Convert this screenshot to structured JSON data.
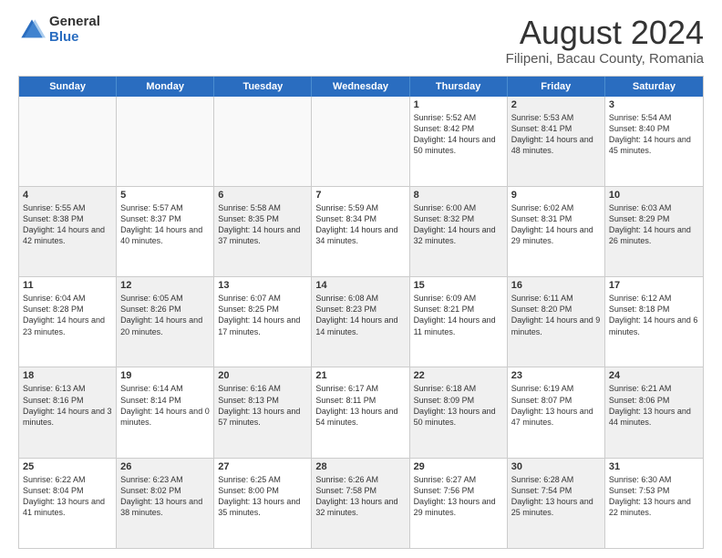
{
  "logo": {
    "general": "General",
    "blue": "Blue"
  },
  "header": {
    "title": "August 2024",
    "subtitle": "Filipeni, Bacau County, Romania"
  },
  "days": [
    "Sunday",
    "Monday",
    "Tuesday",
    "Wednesday",
    "Thursday",
    "Friday",
    "Saturday"
  ],
  "rows": [
    [
      {
        "day": "",
        "text": "",
        "shaded": false,
        "empty": true
      },
      {
        "day": "",
        "text": "",
        "shaded": false,
        "empty": true
      },
      {
        "day": "",
        "text": "",
        "shaded": false,
        "empty": true
      },
      {
        "day": "",
        "text": "",
        "shaded": false,
        "empty": true
      },
      {
        "day": "1",
        "text": "Sunrise: 5:52 AM\nSunset: 8:42 PM\nDaylight: 14 hours and 50 minutes.",
        "shaded": false,
        "empty": false
      },
      {
        "day": "2",
        "text": "Sunrise: 5:53 AM\nSunset: 8:41 PM\nDaylight: 14 hours and 48 minutes.",
        "shaded": true,
        "empty": false
      },
      {
        "day": "3",
        "text": "Sunrise: 5:54 AM\nSunset: 8:40 PM\nDaylight: 14 hours and 45 minutes.",
        "shaded": false,
        "empty": false
      }
    ],
    [
      {
        "day": "4",
        "text": "Sunrise: 5:55 AM\nSunset: 8:38 PM\nDaylight: 14 hours and 42 minutes.",
        "shaded": true,
        "empty": false
      },
      {
        "day": "5",
        "text": "Sunrise: 5:57 AM\nSunset: 8:37 PM\nDaylight: 14 hours and 40 minutes.",
        "shaded": false,
        "empty": false
      },
      {
        "day": "6",
        "text": "Sunrise: 5:58 AM\nSunset: 8:35 PM\nDaylight: 14 hours and 37 minutes.",
        "shaded": true,
        "empty": false
      },
      {
        "day": "7",
        "text": "Sunrise: 5:59 AM\nSunset: 8:34 PM\nDaylight: 14 hours and 34 minutes.",
        "shaded": false,
        "empty": false
      },
      {
        "day": "8",
        "text": "Sunrise: 6:00 AM\nSunset: 8:32 PM\nDaylight: 14 hours and 32 minutes.",
        "shaded": true,
        "empty": false
      },
      {
        "day": "9",
        "text": "Sunrise: 6:02 AM\nSunset: 8:31 PM\nDaylight: 14 hours and 29 minutes.",
        "shaded": false,
        "empty": false
      },
      {
        "day": "10",
        "text": "Sunrise: 6:03 AM\nSunset: 8:29 PM\nDaylight: 14 hours and 26 minutes.",
        "shaded": true,
        "empty": false
      }
    ],
    [
      {
        "day": "11",
        "text": "Sunrise: 6:04 AM\nSunset: 8:28 PM\nDaylight: 14 hours and 23 minutes.",
        "shaded": false,
        "empty": false
      },
      {
        "day": "12",
        "text": "Sunrise: 6:05 AM\nSunset: 8:26 PM\nDaylight: 14 hours and 20 minutes.",
        "shaded": true,
        "empty": false
      },
      {
        "day": "13",
        "text": "Sunrise: 6:07 AM\nSunset: 8:25 PM\nDaylight: 14 hours and 17 minutes.",
        "shaded": false,
        "empty": false
      },
      {
        "day": "14",
        "text": "Sunrise: 6:08 AM\nSunset: 8:23 PM\nDaylight: 14 hours and 14 minutes.",
        "shaded": true,
        "empty": false
      },
      {
        "day": "15",
        "text": "Sunrise: 6:09 AM\nSunset: 8:21 PM\nDaylight: 14 hours and 11 minutes.",
        "shaded": false,
        "empty": false
      },
      {
        "day": "16",
        "text": "Sunrise: 6:11 AM\nSunset: 8:20 PM\nDaylight: 14 hours and 9 minutes.",
        "shaded": true,
        "empty": false
      },
      {
        "day": "17",
        "text": "Sunrise: 6:12 AM\nSunset: 8:18 PM\nDaylight: 14 hours and 6 minutes.",
        "shaded": false,
        "empty": false
      }
    ],
    [
      {
        "day": "18",
        "text": "Sunrise: 6:13 AM\nSunset: 8:16 PM\nDaylight: 14 hours and 3 minutes.",
        "shaded": true,
        "empty": false
      },
      {
        "day": "19",
        "text": "Sunrise: 6:14 AM\nSunset: 8:14 PM\nDaylight: 14 hours and 0 minutes.",
        "shaded": false,
        "empty": false
      },
      {
        "day": "20",
        "text": "Sunrise: 6:16 AM\nSunset: 8:13 PM\nDaylight: 13 hours and 57 minutes.",
        "shaded": true,
        "empty": false
      },
      {
        "day": "21",
        "text": "Sunrise: 6:17 AM\nSunset: 8:11 PM\nDaylight: 13 hours and 54 minutes.",
        "shaded": false,
        "empty": false
      },
      {
        "day": "22",
        "text": "Sunrise: 6:18 AM\nSunset: 8:09 PM\nDaylight: 13 hours and 50 minutes.",
        "shaded": true,
        "empty": false
      },
      {
        "day": "23",
        "text": "Sunrise: 6:19 AM\nSunset: 8:07 PM\nDaylight: 13 hours and 47 minutes.",
        "shaded": false,
        "empty": false
      },
      {
        "day": "24",
        "text": "Sunrise: 6:21 AM\nSunset: 8:06 PM\nDaylight: 13 hours and 44 minutes.",
        "shaded": true,
        "empty": false
      }
    ],
    [
      {
        "day": "25",
        "text": "Sunrise: 6:22 AM\nSunset: 8:04 PM\nDaylight: 13 hours and 41 minutes.",
        "shaded": false,
        "empty": false
      },
      {
        "day": "26",
        "text": "Sunrise: 6:23 AM\nSunset: 8:02 PM\nDaylight: 13 hours and 38 minutes.",
        "shaded": true,
        "empty": false
      },
      {
        "day": "27",
        "text": "Sunrise: 6:25 AM\nSunset: 8:00 PM\nDaylight: 13 hours and 35 minutes.",
        "shaded": false,
        "empty": false
      },
      {
        "day": "28",
        "text": "Sunrise: 6:26 AM\nSunset: 7:58 PM\nDaylight: 13 hours and 32 minutes.",
        "shaded": true,
        "empty": false
      },
      {
        "day": "29",
        "text": "Sunrise: 6:27 AM\nSunset: 7:56 PM\nDaylight: 13 hours and 29 minutes.",
        "shaded": false,
        "empty": false
      },
      {
        "day": "30",
        "text": "Sunrise: 6:28 AM\nSunset: 7:54 PM\nDaylight: 13 hours and 25 minutes.",
        "shaded": true,
        "empty": false
      },
      {
        "day": "31",
        "text": "Sunrise: 6:30 AM\nSunset: 7:53 PM\nDaylight: 13 hours and 22 minutes.",
        "shaded": false,
        "empty": false
      }
    ]
  ]
}
